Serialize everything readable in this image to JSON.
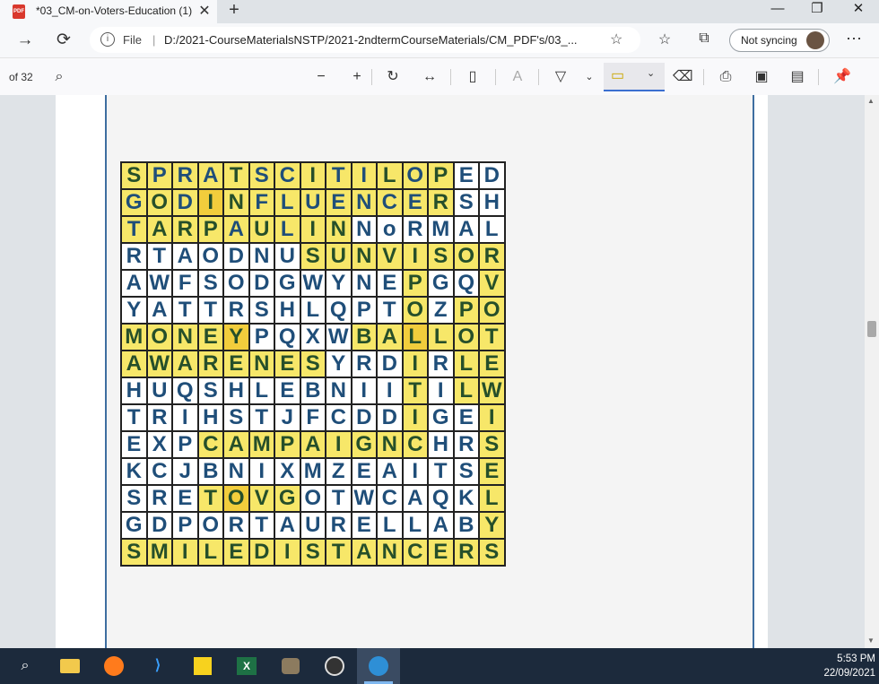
{
  "tab": {
    "title": "*03_CM-on-Voters-Education (1)",
    "pdf_badge": "PDF"
  },
  "window": {
    "minimize": "—",
    "restore": "❐",
    "close": "✕"
  },
  "nav": {
    "file_label": "File",
    "url": "D:/2021-CourseMaterialsNSTP/2021-2ndtermCourseMaterials/CM_PDF's/03_...",
    "sync_label": "Not syncing",
    "more": "···"
  },
  "pdf_toolbar": {
    "page_count": "of 32"
  },
  "puzzle": {
    "rows": [
      [
        "S",
        "P",
        "R",
        "A",
        "T",
        "S",
        "C",
        "I",
        "T",
        "I",
        "L",
        "O",
        "P",
        "E",
        "D"
      ],
      [
        "G",
        "O",
        "D",
        "I",
        "N",
        "F",
        "L",
        "U",
        "E",
        "N",
        "C",
        "E",
        "R",
        "S",
        "H"
      ],
      [
        "T",
        "A",
        "R",
        "P",
        "A",
        "U",
        "L",
        "I",
        "N",
        "N",
        "o",
        "R",
        "M",
        "A",
        "L"
      ],
      [
        "R",
        "T",
        "A",
        "O",
        "D",
        "N",
        "U",
        "S",
        "U",
        "N",
        "V",
        "I",
        "S",
        "O",
        "R"
      ],
      [
        "A",
        "W",
        "F",
        "S",
        "O",
        "D",
        "G",
        "W",
        "Y",
        "N",
        "E",
        "P",
        "G",
        "Q",
        "V"
      ],
      [
        "Y",
        "A",
        "T",
        "T",
        "R",
        "S",
        "H",
        "L",
        "Q",
        "P",
        "T",
        "O",
        "Z",
        "P",
        "O"
      ],
      [
        "M",
        "O",
        "N",
        "E",
        "Y",
        "P",
        "Q",
        "X",
        "W",
        "B",
        "A",
        "L",
        "L",
        "O",
        "T"
      ],
      [
        "A",
        "W",
        "A",
        "R",
        "E",
        "N",
        "E",
        "S",
        "Y",
        "R",
        "D",
        "I",
        "R",
        "L",
        "E"
      ],
      [
        "H",
        "U",
        "Q",
        "S",
        "H",
        "L",
        "E",
        "B",
        "N",
        "I",
        "I",
        "T",
        "I",
        "L",
        "W"
      ],
      [
        "T",
        "R",
        "I",
        "H",
        "S",
        "T",
        "J",
        "F",
        "C",
        "D",
        "D",
        "I",
        "G",
        "E",
        "I"
      ],
      [
        "E",
        "X",
        "P",
        "C",
        "A",
        "M",
        "P",
        "A",
        "I",
        "G",
        "N",
        "C",
        "H",
        "R",
        "S"
      ],
      [
        "K",
        "C",
        "J",
        "B",
        "N",
        "I",
        "X",
        "M",
        "Z",
        "E",
        "A",
        "I",
        "T",
        "S",
        "E"
      ],
      [
        "S",
        "R",
        "E",
        "T",
        "O",
        "V",
        "G",
        "O",
        "T",
        "W",
        "C",
        "A",
        "Q",
        "K",
        "L"
      ],
      [
        "G",
        "D",
        "P",
        "O",
        "R",
        "T",
        "A",
        "U",
        "R",
        "E",
        "L",
        "L",
        "A",
        "B",
        "Y"
      ],
      [
        "S",
        "M",
        "I",
        "L",
        "E",
        "D",
        "I",
        "S",
        "T",
        "A",
        "N",
        "C",
        "E",
        "R",
        "S"
      ]
    ]
  },
  "taskbar": {
    "time": "5:53 PM",
    "date": "22/09/2021"
  }
}
